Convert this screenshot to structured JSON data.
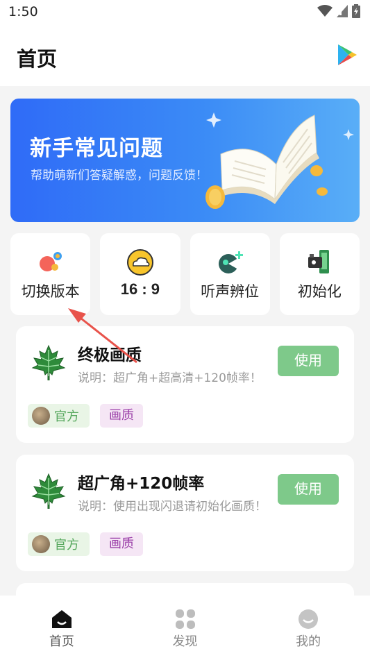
{
  "status_bar": {
    "time": "1:50",
    "icons": [
      "wifi-icon",
      "signal-icon",
      "battery-icon"
    ]
  },
  "header": {
    "title": "首页",
    "icons": [
      "google-play-icon"
    ]
  },
  "banner": {
    "title": "新手常见问题",
    "subtitle": "帮助萌新们答疑解惑，问题反馈！",
    "art": "open-book-illustration"
  },
  "quick_actions": [
    {
      "label": "切换版本",
      "icon": "switch-version-icon"
    },
    {
      "label": "16 : 9",
      "icon": "cloud-icon"
    },
    {
      "label": "听声辨位",
      "icon": "sound-locate-icon"
    },
    {
      "label": "初始化",
      "icon": "reset-icon"
    }
  ],
  "cards": [
    {
      "title": "终极画质",
      "description": "说明：超广角+超高清+120帧率！",
      "button_label": "使用",
      "tag_official": "官方",
      "tag_quality": "画质",
      "icon": "maple-leaf-icon"
    },
    {
      "title": "超广角+120帧率",
      "description": "说明：使用出现闪退请初始化画质！",
      "button_label": "使用",
      "tag_official": "官方",
      "tag_quality": "画质",
      "icon": "maple-leaf-icon"
    }
  ],
  "bottom_nav": [
    {
      "label": "首页",
      "icon": "home-icon",
      "active": true
    },
    {
      "label": "发现",
      "icon": "discover-icon",
      "active": false
    },
    {
      "label": "我的",
      "icon": "profile-icon",
      "active": false
    }
  ],
  "colors": {
    "banner_start": "#2f6bf7",
    "banner_end": "#59aef7",
    "use_button": "#7ec98a",
    "tag_official_bg": "#e9f5e6",
    "tag_quality_bg": "#f5e6f5",
    "annotation_arrow": "#e8534b"
  }
}
